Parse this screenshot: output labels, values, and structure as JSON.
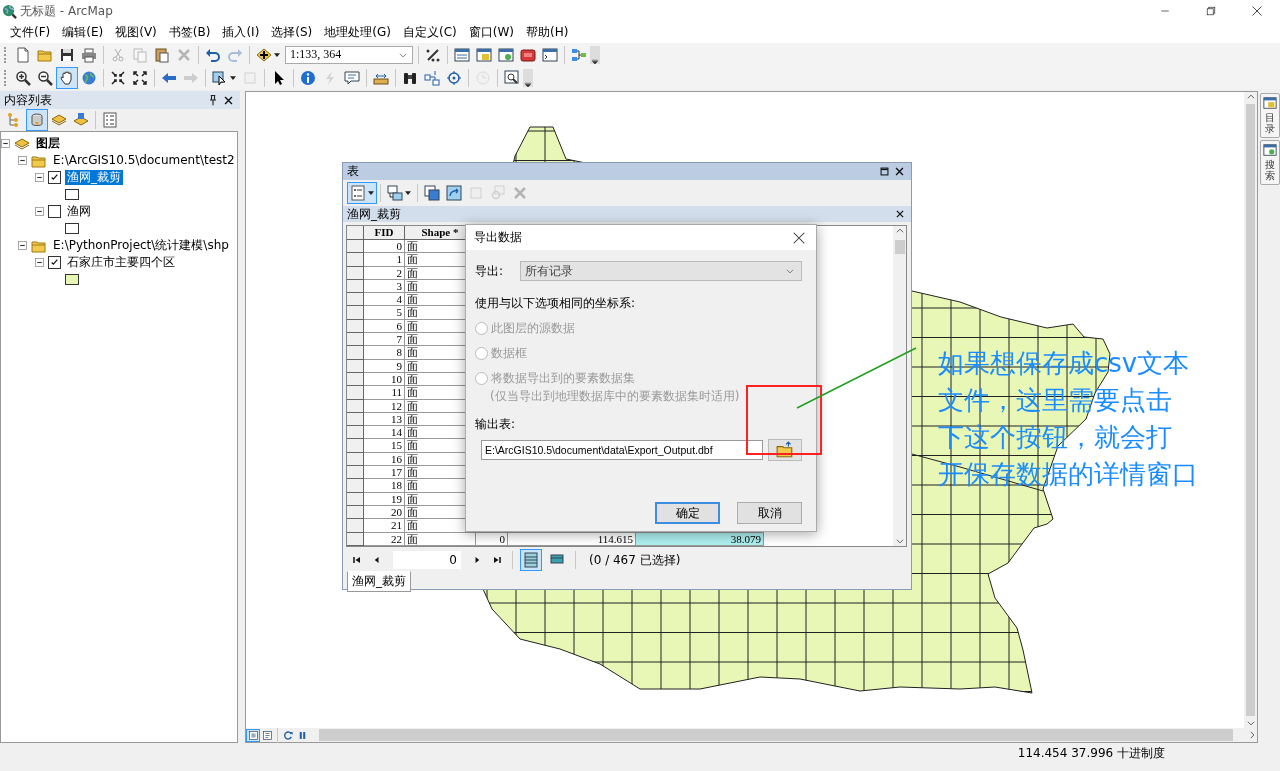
{
  "window": {
    "title": "无标题 - ArcMap"
  },
  "menu": [
    "文件(F)",
    "编辑(E)",
    "视图(V)",
    "书签(B)",
    "插入(I)",
    "选择(S)",
    "地理处理(G)",
    "自定义(C)",
    "窗口(W)",
    "帮助(H)"
  ],
  "toolbar_1": {
    "items": [
      {
        "kind": "button",
        "selected": false,
        "disabled": false
      },
      {
        "kind": "button",
        "selected": false,
        "disabled": false
      },
      {
        "kind": "button",
        "selected": false,
        "disabled": false
      },
      {
        "kind": "button",
        "selected": false,
        "disabled": false
      },
      {
        "kind": "separator"
      },
      {
        "kind": "button",
        "selected": false,
        "disabled": true
      },
      {
        "kind": "button",
        "selected": false,
        "disabled": true
      },
      {
        "kind": "button",
        "selected": false,
        "disabled": false
      },
      {
        "kind": "button",
        "selected": false,
        "disabled": true
      },
      {
        "kind": "separator"
      },
      {
        "kind": "button",
        "selected": false,
        "disabled": false
      },
      {
        "kind": "button",
        "selected": false,
        "disabled": true
      },
      {
        "kind": "separator"
      },
      {
        "kind": "dropdown",
        "selected": false,
        "disabled": false
      },
      {
        "kind": "combo",
        "value": "1:133, 364"
      },
      {
        "kind": "separator"
      },
      {
        "kind": "button",
        "selected": false,
        "disabled": false
      },
      {
        "kind": "separator"
      },
      {
        "kind": "button",
        "selected": false,
        "disabled": false
      },
      {
        "kind": "button",
        "selected": false,
        "disabled": false
      },
      {
        "kind": "button",
        "selected": false,
        "disabled": false
      },
      {
        "kind": "button",
        "selected": false,
        "disabled": false
      },
      {
        "kind": "button",
        "selected": false,
        "disabled": false
      },
      {
        "kind": "separator"
      },
      {
        "kind": "button",
        "selected": false,
        "disabled": false
      }
    ]
  },
  "toolbar_2": {
    "items": [
      {
        "kind": "button",
        "selected": false,
        "disabled": false
      },
      {
        "kind": "button",
        "selected": false,
        "disabled": false
      },
      {
        "kind": "button",
        "selected": true,
        "disabled": false
      },
      {
        "kind": "button",
        "selected": false,
        "disabled": false
      },
      {
        "kind": "separator"
      },
      {
        "kind": "button",
        "selected": false,
        "disabled": false
      },
      {
        "kind": "button",
        "selected": false,
        "disabled": false
      },
      {
        "kind": "separator"
      },
      {
        "kind": "button",
        "selected": false,
        "disabled": false
      },
      {
        "kind": "button",
        "selected": false,
        "disabled": true
      },
      {
        "kind": "separator"
      },
      {
        "kind": "dropdown",
        "selected": false,
        "disabled": false
      },
      {
        "kind": "button",
        "selected": false,
        "disabled": true
      },
      {
        "kind": "separator"
      },
      {
        "kind": "button",
        "selected": false,
        "disabled": false
      },
      {
        "kind": "separator"
      },
      {
        "kind": "button",
        "selected": false,
        "disabled": false
      },
      {
        "kind": "button",
        "selected": false,
        "disabled": true
      },
      {
        "kind": "button",
        "selected": false,
        "disabled": false
      },
      {
        "kind": "separator"
      },
      {
        "kind": "button",
        "selected": false,
        "disabled": false
      },
      {
        "kind": "separator"
      },
      {
        "kind": "button",
        "selected": false,
        "disabled": false
      },
      {
        "kind": "button",
        "selected": false,
        "disabled": false
      },
      {
        "kind": "button",
        "selected": false,
        "disabled": false
      },
      {
        "kind": "separator"
      },
      {
        "kind": "button",
        "selected": false,
        "disabled": true
      },
      {
        "kind": "separator"
      },
      {
        "kind": "button",
        "selected": false,
        "disabled": false
      }
    ]
  },
  "toc": {
    "title": "内容列表",
    "toolbar": [
      {
        "kind": "button",
        "selected": false,
        "disabled": false
      },
      {
        "kind": "button",
        "selected": true,
        "disabled": false
      },
      {
        "kind": "button",
        "selected": false,
        "disabled": false
      },
      {
        "kind": "button",
        "selected": false,
        "disabled": false
      },
      {
        "kind": "separator"
      },
      {
        "kind": "button",
        "selected": false,
        "disabled": false
      }
    ],
    "tree": [
      {
        "kind": "root",
        "label": "图层",
        "expanded": true,
        "children": [
          {
            "kind": "folder",
            "label": "E:\\ArcGIS10.5\\document\\test2",
            "expanded": true,
            "children": [
              {
                "kind": "layer",
                "label": "渔网_裁剪",
                "expanded": true,
                "checked": true,
                "selected": true,
                "color": "#ffffff"
              },
              {
                "kind": "layer",
                "label": "渔网",
                "expanded": true,
                "checked": false,
                "selected": false,
                "color": "#ffffff"
              }
            ]
          },
          {
            "kind": "folder",
            "label": "E:\\PythonProject\\统计建模\\shp",
            "expanded": true,
            "children": [
              {
                "kind": "layer",
                "label": "石家庄市主要四个区",
                "expanded": true,
                "checked": true,
                "selected": false,
                "color": "#e6f7b5"
              }
            ]
          }
        ]
      }
    ]
  },
  "map": {
    "view_buttons": [
      {
        "selected": true
      },
      {
        "selected": false
      }
    ]
  },
  "annotation": {
    "lines": [
      "如果想保存成csv文本",
      "文件，这里需要点击",
      "下这个按钮，就会打",
      "开保存数据的详情窗口"
    ]
  },
  "dock_tabs": [
    {
      "label": "目录"
    },
    {
      "label": "搜索"
    }
  ],
  "table_window": {
    "title": "表",
    "toolbar": [
      {
        "kind": "dropdown",
        "selected": true,
        "disabled": false
      },
      {
        "kind": "separator"
      },
      {
        "kind": "dropdown",
        "selected": false,
        "disabled": false
      },
      {
        "kind": "separator"
      },
      {
        "kind": "button",
        "selected": false,
        "disabled": false
      },
      {
        "kind": "button",
        "selected": false,
        "disabled": false
      },
      {
        "kind": "button",
        "selected": false,
        "disabled": true
      },
      {
        "kind": "button",
        "selected": false,
        "disabled": true
      },
      {
        "kind": "button",
        "selected": false,
        "disabled": true
      }
    ],
    "layer_title": "渔网_裁剪",
    "columns": [
      {
        "label": "FID",
        "selected": false
      },
      {
        "label": "Shape *",
        "selected": false
      },
      {
        "selected": false
      },
      {
        "selected": false
      },
      {
        "selected": true
      }
    ],
    "rows": [
      {
        "cells": [
          "0",
          "面"
        ]
      },
      {
        "cells": [
          "1",
          "面"
        ]
      },
      {
        "cells": [
          "2",
          "面"
        ]
      },
      {
        "cells": [
          "3",
          "面"
        ]
      },
      {
        "cells": [
          "4",
          "面"
        ]
      },
      {
        "cells": [
          "5",
          "面"
        ]
      },
      {
        "cells": [
          "6",
          "面"
        ]
      },
      {
        "cells": [
          "7",
          "面"
        ]
      },
      {
        "cells": [
          "8",
          "面"
        ]
      },
      {
        "cells": [
          "9",
          "面"
        ]
      },
      {
        "cells": [
          "10",
          "面"
        ]
      },
      {
        "cells": [
          "11",
          "面"
        ]
      },
      {
        "cells": [
          "12",
          "面"
        ]
      },
      {
        "cells": [
          "13",
          "面"
        ]
      },
      {
        "cells": [
          "14",
          "面"
        ]
      },
      {
        "cells": [
          "15",
          "面"
        ]
      },
      {
        "cells": [
          "16",
          "面"
        ]
      },
      {
        "cells": [
          "17",
          "面"
        ]
      },
      {
        "cells": [
          "18",
          "面"
        ]
      },
      {
        "cells": [
          "19",
          "面"
        ]
      },
      {
        "cells": [
          "20",
          "面"
        ]
      },
      {
        "cells": [
          "21",
          "面"
        ]
      },
      {
        "cells": [
          "22",
          "面",
          "0",
          "114.615",
          "38.079"
        ]
      }
    ],
    "navigation": {
      "record": "0",
      "status": "(0 / 467 已选择)",
      "views": [
        {
          "selected": true
        },
        {
          "selected": false
        }
      ]
    },
    "tabs": [
      {
        "label": "渔网_裁剪",
        "selected": true
      }
    ]
  },
  "export_dialog": {
    "title": "导出数据",
    "export_label": "导出:",
    "export_value": "所有记录",
    "export_disabled": true,
    "coord_label": "使用与以下选项相同的坐标系:",
    "options": [
      {
        "label": "此图层的源数据",
        "selected": false,
        "disabled": true
      },
      {
        "label": "数据框",
        "selected": false,
        "disabled": true
      },
      {
        "label": "将数据导出到的要素数据集",
        "note": "(仅当导出到地理数据库中的要素数据集时适用)",
        "selected": false,
        "disabled": true
      }
    ],
    "output_label": "输出表:",
    "output_value": "E:\\ArcGIS10.5\\document\\data\\Export_Output.dbf",
    "buttons": [
      {
        "label": "确定",
        "default": true
      },
      {
        "label": "取消",
        "default": false
      }
    ]
  },
  "status_bar": {
    "coordinates": "114.454  37.996 十进制度"
  }
}
